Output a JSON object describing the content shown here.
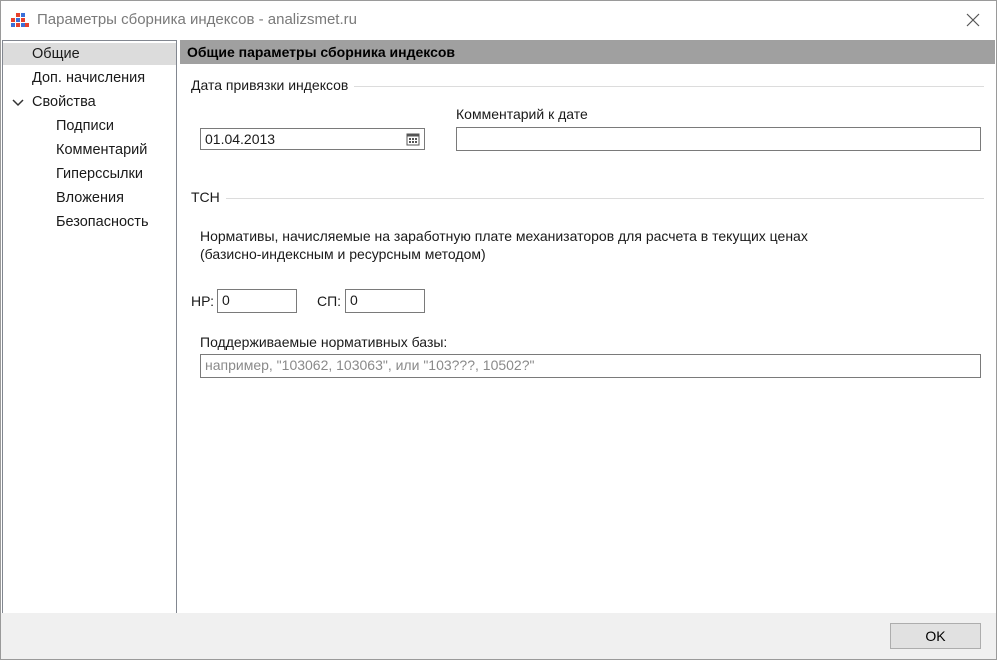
{
  "window": {
    "title": "Параметры сборника индексов - analizsmet.ru"
  },
  "sidebar": {
    "items": [
      {
        "label": "Общие",
        "selected": true
      },
      {
        "label": "Доп. начисления"
      },
      {
        "label": "Свойства",
        "expanded": true,
        "icon": "chevron-down-icon"
      },
      {
        "label": "Подписи"
      },
      {
        "label": "Комментарий"
      },
      {
        "label": "Гиперссылки"
      },
      {
        "label": "Вложения"
      },
      {
        "label": "Безопасность"
      }
    ]
  },
  "main": {
    "header": "Общие параметры сборника индексов",
    "date_group": {
      "label": "Дата привязки индексов",
      "date_value": "01.04.2013",
      "date_icon": "calendar-icon",
      "comment_label": "Комментарий к дате",
      "comment_value": ""
    },
    "tsn_group": {
      "label": "ТСН",
      "description_line1": "Нормативы, начисляемые на заработную плате механизаторов для расчета в текущих ценах",
      "description_line2": "(базисно-индексным и ресурсным методом)",
      "hp_label": "НР:",
      "hp_value": "0",
      "sp_label": "СП:",
      "sp_value": "0",
      "bases_label": "Поддерживаемые нормативных базы:",
      "bases_placeholder": "например, \"103062, 103063\", или \"103???, 10502?\"",
      "bases_value": ""
    }
  },
  "footer": {
    "ok_label": "OK"
  },
  "colors": {
    "header_bar": "#a0a0a0",
    "selected_item": "#dcdcdc",
    "footer_bg": "#f0f0f0"
  }
}
